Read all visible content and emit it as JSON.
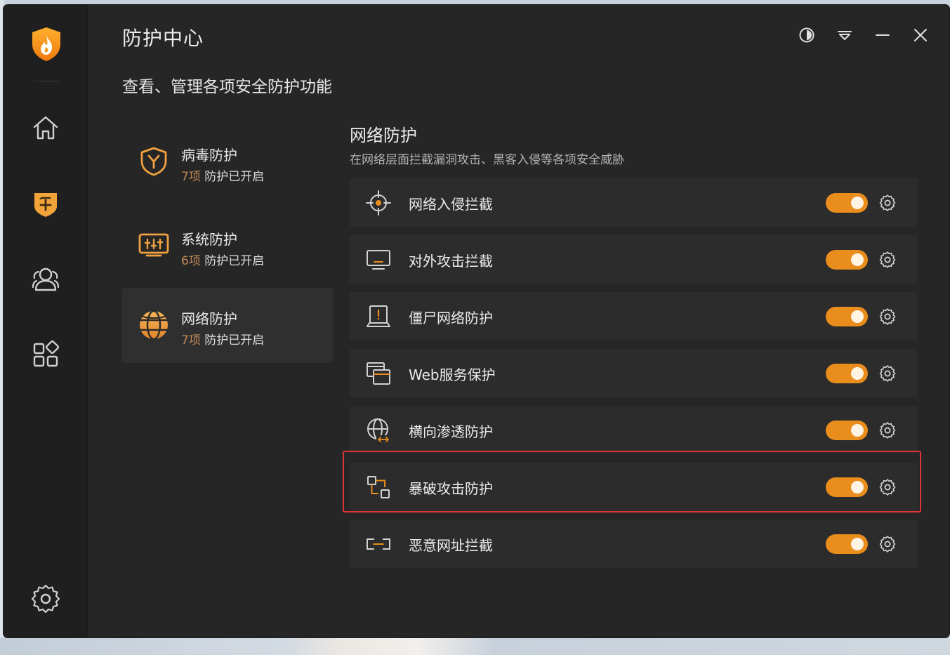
{
  "app": {
    "title": "防护中心",
    "subtitle": "查看、管理各项安全防护功能"
  },
  "colors": {
    "accent": "#e98d1c",
    "highlight": "#e0343a"
  },
  "sidebar": {
    "items": [
      {
        "name": "home",
        "icon": "home-icon"
      },
      {
        "name": "protection",
        "icon": "shield-plus-icon",
        "active": true
      },
      {
        "name": "users",
        "icon": "users-icon"
      },
      {
        "name": "apps",
        "icon": "apps-grid-icon"
      },
      {
        "name": "settings",
        "icon": "gear-icon"
      }
    ]
  },
  "window_controls": [
    "theme-icon",
    "dropdown-icon",
    "minimize-icon",
    "close-icon"
  ],
  "categories": [
    {
      "title": "病毒防护",
      "count": "7项",
      "status": "防护已开启",
      "active": false
    },
    {
      "title": "系统防护",
      "count": "6项",
      "status": "防护已开启",
      "active": false
    },
    {
      "title": "网络防护",
      "count": "7项",
      "status": "防护已开启",
      "active": true
    }
  ],
  "section": {
    "title": "网络防护",
    "desc": "在网络层面拦截漏洞攻击、黑客入侵等各项安全威胁"
  },
  "features": [
    {
      "label": "网络入侵拦截",
      "icon": "crosshair-icon",
      "enabled": true
    },
    {
      "label": "对外攻击拦截",
      "icon": "monitor-icon",
      "enabled": true
    },
    {
      "label": "僵尸网络防护",
      "icon": "laptop-alert-icon",
      "enabled": true
    },
    {
      "label": "Web服务保护",
      "icon": "web-windows-icon",
      "enabled": true
    },
    {
      "label": "横向渗透防护",
      "icon": "globe-arrows-icon",
      "enabled": true
    },
    {
      "label": "暴破攻击防护",
      "icon": "connected-squares-icon",
      "enabled": true
    },
    {
      "label": "恶意网址拦截",
      "icon": "link-block-icon",
      "enabled": true
    }
  ]
}
